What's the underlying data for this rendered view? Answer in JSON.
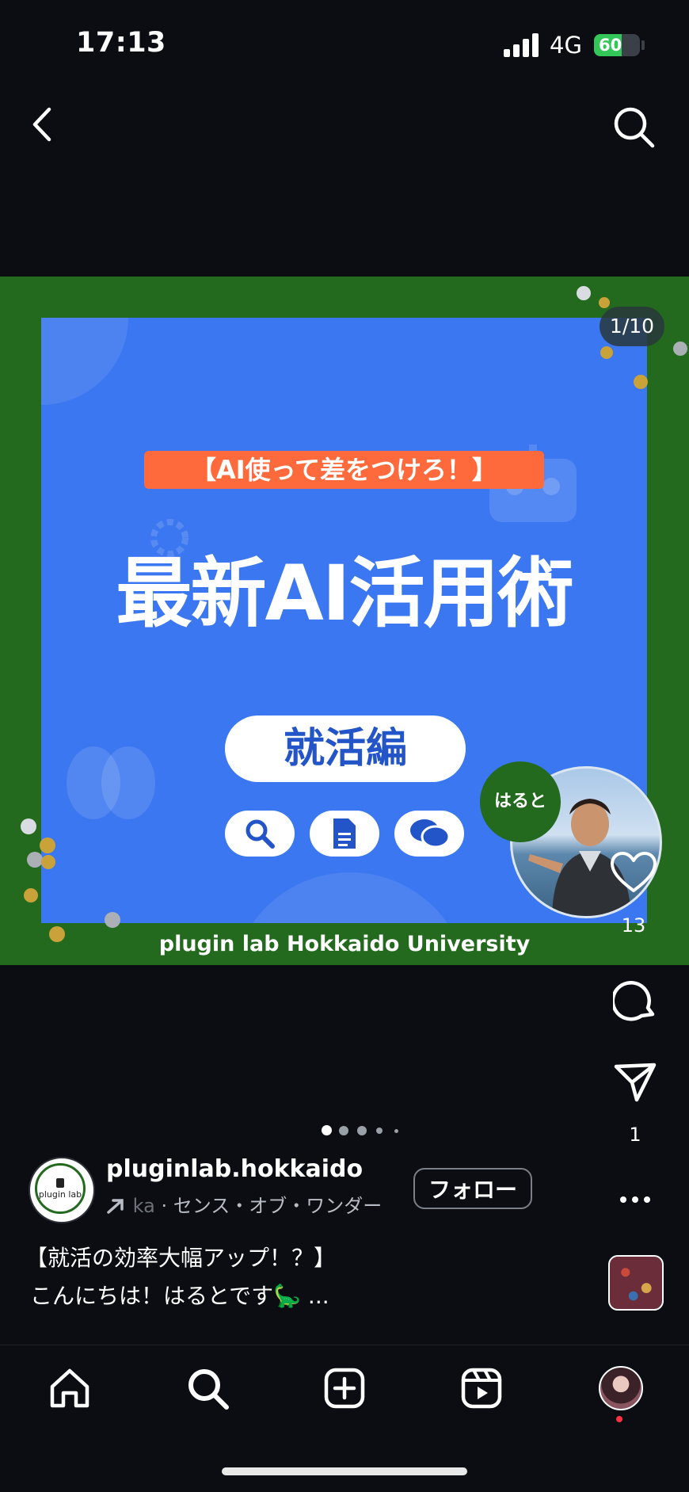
{
  "status_bar": {
    "time": "17:13",
    "network": "4G",
    "battery": "60",
    "battery_level": 0.6
  },
  "post": {
    "page_indicator": "1/10",
    "tagline": "【AI使って差をつけろ！】",
    "headline": "最新AI活用術",
    "subheadline": "就活編",
    "name_badge": "はると",
    "footer": "plugin lab  Hokkaido University",
    "like_count": "13",
    "share_count": "1",
    "carousel": {
      "total_dots": 5,
      "active_index": 0
    }
  },
  "account": {
    "avatar_text": "plugin lab",
    "username": "pluginlab.hokkaido",
    "audio_prefix": "ka",
    "audio_title": " · センス・オブ・ワンダー",
    "follow_label": "フォロー"
  },
  "caption": {
    "line1": "【就活の効率大幅アップ！？】",
    "line2": "こんにちは！はるとです🦕 ..."
  },
  "icons": {
    "back": "chevron-left-icon",
    "search": "search-icon",
    "heart": "heart-icon",
    "comment": "comment-icon",
    "share": "send-icon",
    "more": "more-icon",
    "home": "home-icon",
    "explore": "search-icon",
    "create": "plus-square-icon",
    "reels": "reels-icon"
  },
  "colors": {
    "background": "#0b0d12",
    "media_green": "#236a1e",
    "slide_blue": "#3b77f0",
    "tag_orange": "#ff6a3d",
    "notification": "#ff3040"
  }
}
